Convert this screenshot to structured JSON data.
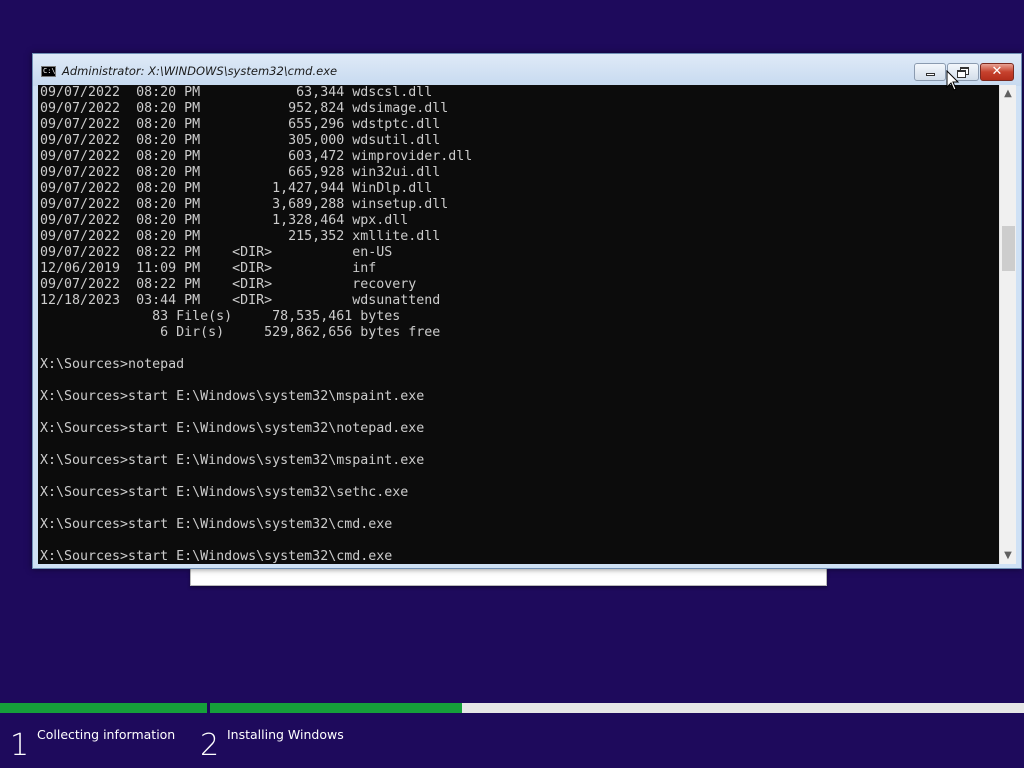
{
  "window": {
    "title": "Administrator: X:\\WINDOWS\\system32\\cmd.exe",
    "icon_text": "C:\\",
    "buttons": {
      "minimize": "minimize-icon",
      "maximize": "restore-icon",
      "close": "✕"
    }
  },
  "console": {
    "lines": [
      "09/07/2022  08:20 PM            63,344 wdscsl.dll",
      "09/07/2022  08:20 PM           952,824 wdsimage.dll",
      "09/07/2022  08:20 PM           655,296 wdstptc.dll",
      "09/07/2022  08:20 PM           305,000 wdsutil.dll",
      "09/07/2022  08:20 PM           603,472 wimprovider.dll",
      "09/07/2022  08:20 PM           665,928 win32ui.dll",
      "09/07/2022  08:20 PM         1,427,944 WinDlp.dll",
      "09/07/2022  08:20 PM         3,689,288 winsetup.dll",
      "09/07/2022  08:20 PM         1,328,464 wpx.dll",
      "09/07/2022  08:20 PM           215,352 xmllite.dll",
      "09/07/2022  08:22 PM    <DIR>          en-US",
      "12/06/2019  11:09 PM    <DIR>          inf",
      "09/07/2022  08:22 PM    <DIR>          recovery",
      "12/18/2023  03:44 PM    <DIR>          wdsunattend",
      "              83 File(s)     78,535,461 bytes",
      "               6 Dir(s)     529,862,656 bytes free",
      "",
      "X:\\Sources>notepad",
      "",
      "X:\\Sources>start E:\\Windows\\system32\\mspaint.exe",
      "",
      "X:\\Sources>start E:\\Windows\\system32\\notepad.exe",
      "",
      "X:\\Sources>start E:\\Windows\\system32\\mspaint.exe",
      "",
      "X:\\Sources>start E:\\Windows\\system32\\sethc.exe",
      "",
      "X:\\Sources>start E:\\Windows\\system32\\cmd.exe",
      "",
      "X:\\Sources>start E:\\Windows\\system32\\cmd.exe"
    ]
  },
  "scrollbar": {
    "up": "▲",
    "down": "▼"
  },
  "setup_progress": {
    "steps": [
      {
        "number": "1",
        "label": "Collecting information",
        "progress": 1.0
      },
      {
        "number": "2",
        "label": "Installing Windows",
        "progress": 0.31
      }
    ],
    "colors": {
      "fill": "#16a03a",
      "track": "#e6e6e6",
      "background": "#1e0a5c"
    }
  }
}
